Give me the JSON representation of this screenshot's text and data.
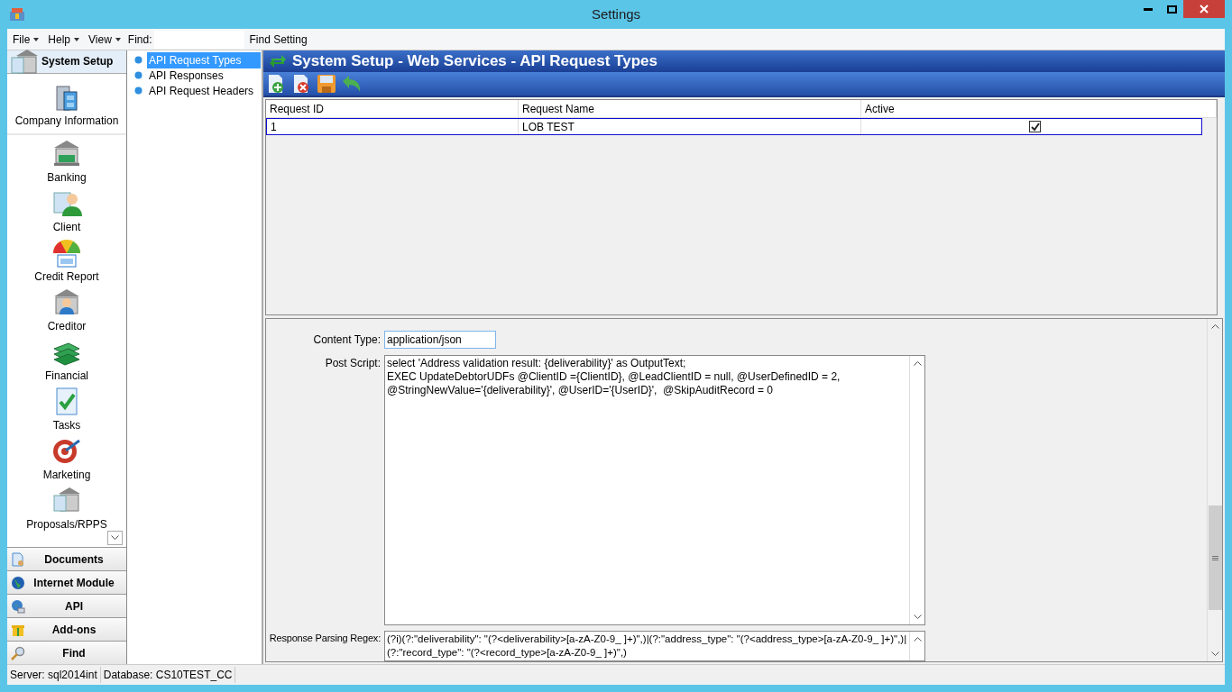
{
  "window": {
    "title": "Settings"
  },
  "menu": [
    {
      "label": "File",
      "dropdown": true
    },
    {
      "label": "Help",
      "dropdown": true
    },
    {
      "label": "View",
      "dropdown": true
    }
  ],
  "find": {
    "label": "Find:",
    "button": "Find Setting"
  },
  "nav": {
    "header": "System Setup",
    "items": [
      {
        "label": "Company Information",
        "kind": "building"
      },
      {
        "label": "Banking",
        "kind": "bank"
      },
      {
        "label": "Client",
        "kind": "client"
      },
      {
        "label": "Credit Report",
        "kind": "gauge"
      },
      {
        "label": "Creditor",
        "kind": "creditor"
      },
      {
        "label": "Financial",
        "kind": "money"
      },
      {
        "label": "Tasks",
        "kind": "tasks"
      },
      {
        "label": "Marketing",
        "kind": "target"
      },
      {
        "label": "Proposals/RPPS",
        "kind": "proposal"
      }
    ],
    "sections": [
      {
        "label": "Documents",
        "kind": "document"
      },
      {
        "label": "Internet Module",
        "kind": "globe"
      },
      {
        "label": "API",
        "kind": "api"
      },
      {
        "label": "Add-ons",
        "kind": "gift"
      },
      {
        "label": "Find",
        "kind": "magnifier"
      }
    ]
  },
  "tree": [
    {
      "label": "API Request Types",
      "selected": true
    },
    {
      "label": "API Responses",
      "selected": false
    },
    {
      "label": "API Request Headers",
      "selected": false
    }
  ],
  "panel": {
    "title": "System Setup - Web Services - API Request Types"
  },
  "table": {
    "columns": [
      "Request ID",
      "Request Name",
      "Active"
    ],
    "rows": [
      {
        "request_id": "1",
        "request_name": "LOB TEST",
        "active": true,
        "selected": true
      }
    ]
  },
  "form": {
    "content_type": {
      "label": "Content Type:",
      "value": "application/json"
    },
    "post_script": {
      "label": "Post Script:",
      "lines": [
        "select 'Address validation result: {deliverability}' as OutputText;",
        "EXEC UpdateDebtorUDFs @ClientID ={ClientID}, @LeadClientID = null, @UserDefinedID = 2,",
        "@StringNewValue='{deliverability}', @UserID='{UserID}',  @SkipAuditRecord = 0"
      ]
    },
    "regex": {
      "label": "Response Parsing Regex:",
      "lines": [
        "(?i)(?:\"deliverability\": \"(?<deliverability>[a-zA-Z0-9_ ]+)\",)|(?:\"address_type\": \"(?<address_type>[a-zA-Z0-9_ ]+)\",)|",
        "(?:\"record_type\": \"(?<record_type>[a-zA-Z0-9_ ]+)\",)"
      ]
    }
  },
  "status_bar": [
    "Server: sql2014int",
    "Database: CS10TEST_CC"
  ]
}
